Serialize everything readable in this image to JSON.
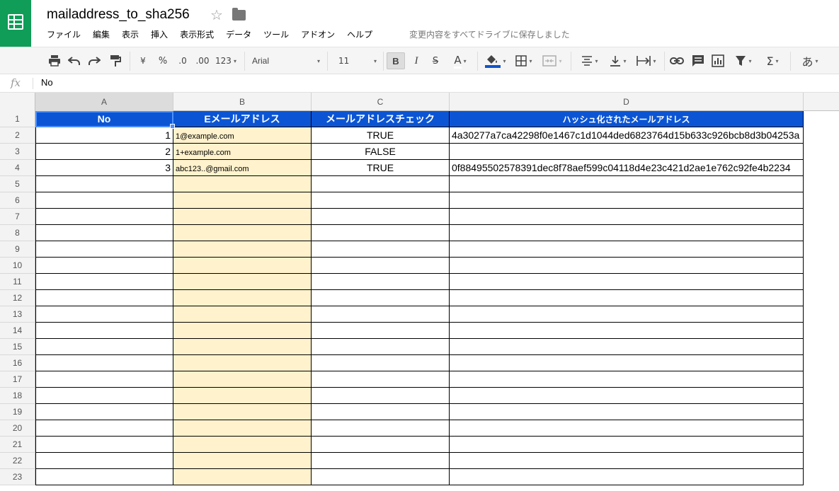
{
  "doc": {
    "title": "mailaddress_to_sha256",
    "save_status": "変更内容をすべてドライブに保存しました"
  },
  "menu": [
    "ファイル",
    "編集",
    "表示",
    "挿入",
    "表示形式",
    "データ",
    "ツール",
    "アドオン",
    "ヘルプ"
  ],
  "toolbar": {
    "currency": "¥",
    "percent": "%",
    "dec_decrease": ".0",
    "dec_increase": ".00",
    "more_formats": "123",
    "font": "Arial",
    "font_size": "11",
    "bold": "B",
    "italic": "I",
    "strike": "S",
    "text_color": "A",
    "input_tools": "あ",
    "colors": {
      "fill_accent": "#1155cc",
      "header_bg": "#0b55d4",
      "email_col_bg": "#fff2cc"
    }
  },
  "formula": {
    "fx": "fx",
    "value": "No"
  },
  "grid": {
    "columns": [
      "A",
      "B",
      "C",
      "D"
    ],
    "header_row": {
      "num": "1",
      "a": "No",
      "b": "Eメールアドレス",
      "c": "メールアドレスチェック",
      "d": "ハッシュ化されたメールアドレス"
    },
    "rows": [
      {
        "num": "2",
        "a": "1",
        "b": "1@example.com",
        "c": "TRUE",
        "d": "4a30277a7ca42298f0e1467c1d1044ded6823764d15b633c926bcb8d3b04253a"
      },
      {
        "num": "3",
        "a": "2",
        "b": "1+example.com",
        "c": "FALSE",
        "d": ""
      },
      {
        "num": "4",
        "a": "3",
        "b": "abc123..@gmail.com",
        "c": "TRUE",
        "d": "0f88495502578391dec8f78aef599c04118d4e23c421d2ae1e762c92fe4b2234"
      },
      {
        "num": "5",
        "a": "",
        "b": "",
        "c": "",
        "d": ""
      },
      {
        "num": "6",
        "a": "",
        "b": "",
        "c": "",
        "d": ""
      },
      {
        "num": "7",
        "a": "",
        "b": "",
        "c": "",
        "d": ""
      },
      {
        "num": "8",
        "a": "",
        "b": "",
        "c": "",
        "d": ""
      },
      {
        "num": "9",
        "a": "",
        "b": "",
        "c": "",
        "d": ""
      },
      {
        "num": "10",
        "a": "",
        "b": "",
        "c": "",
        "d": ""
      },
      {
        "num": "11",
        "a": "",
        "b": "",
        "c": "",
        "d": ""
      },
      {
        "num": "12",
        "a": "",
        "b": "",
        "c": "",
        "d": ""
      },
      {
        "num": "13",
        "a": "",
        "b": "",
        "c": "",
        "d": ""
      },
      {
        "num": "14",
        "a": "",
        "b": "",
        "c": "",
        "d": ""
      },
      {
        "num": "15",
        "a": "",
        "b": "",
        "c": "",
        "d": ""
      },
      {
        "num": "16",
        "a": "",
        "b": "",
        "c": "",
        "d": ""
      },
      {
        "num": "17",
        "a": "",
        "b": "",
        "c": "",
        "d": ""
      },
      {
        "num": "18",
        "a": "",
        "b": "",
        "c": "",
        "d": ""
      },
      {
        "num": "19",
        "a": "",
        "b": "",
        "c": "",
        "d": ""
      },
      {
        "num": "20",
        "a": "",
        "b": "",
        "c": "",
        "d": ""
      },
      {
        "num": "21",
        "a": "",
        "b": "",
        "c": "",
        "d": ""
      },
      {
        "num": "22",
        "a": "",
        "b": "",
        "c": "",
        "d": ""
      },
      {
        "num": "23",
        "a": "",
        "b": "",
        "c": "",
        "d": ""
      }
    ]
  }
}
